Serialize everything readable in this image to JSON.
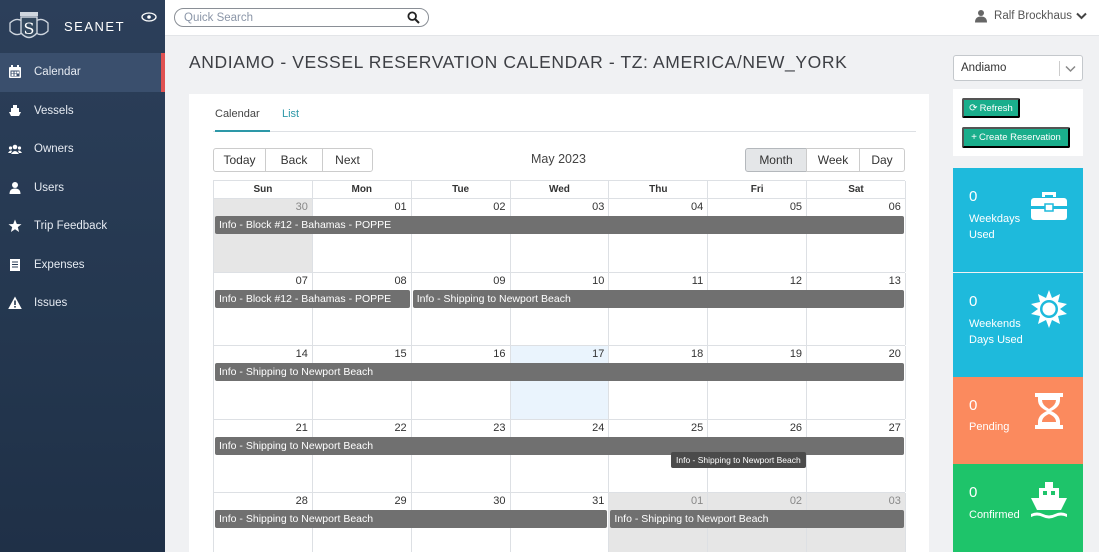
{
  "brand": {
    "name": "SEANET",
    "logo_letter": "S"
  },
  "sidebar": {
    "items": [
      {
        "label": "Calendar",
        "icon": "calendar-icon",
        "active": true
      },
      {
        "label": "Vessels",
        "icon": "ship-icon"
      },
      {
        "label": "Owners",
        "icon": "users-icon"
      },
      {
        "label": "Users",
        "icon": "user-icon"
      },
      {
        "label": "Trip Feedback",
        "icon": "star-icon"
      },
      {
        "label": "Expenses",
        "icon": "receipt-icon"
      },
      {
        "label": "Issues",
        "icon": "warning-icon"
      }
    ]
  },
  "topbar": {
    "search_placeholder": "Quick Search",
    "user_name": "Ralf Brockhaus"
  },
  "page": {
    "title": "ANDIAMO - VESSEL RESERVATION CALENDAR - TZ: AMERICA/NEW_YORK"
  },
  "calendar": {
    "tabs": [
      "Calendar",
      "List"
    ],
    "nav_buttons": [
      "Today",
      "Back",
      "Next"
    ],
    "month_label": "May 2023",
    "view_buttons": [
      "Month",
      "Week",
      "Day"
    ],
    "active_view": "Month",
    "weekdays": [
      "Sun",
      "Mon",
      "Tue",
      "Wed",
      "Thu",
      "Fri",
      "Sat"
    ],
    "weeks": [
      {
        "days": [
          "30",
          "01",
          "02",
          "03",
          "04",
          "05",
          "06"
        ],
        "off": [
          0
        ],
        "today": -1,
        "events": [
          {
            "title": "Info - Block #12 - Bahamas - POPPE",
            "start": 0,
            "span": 7
          }
        ]
      },
      {
        "days": [
          "07",
          "08",
          "09",
          "10",
          "11",
          "12",
          "13"
        ],
        "off": [],
        "today": -1,
        "events": [
          {
            "title": "Info - Block #12 - Bahamas - POPPE",
            "start": 0,
            "span": 2
          },
          {
            "title": "Info - Shipping to Newport Beach",
            "start": 2,
            "span": 5
          }
        ]
      },
      {
        "days": [
          "14",
          "15",
          "16",
          "17",
          "18",
          "19",
          "20"
        ],
        "off": [],
        "today": 3,
        "events": [
          {
            "title": "Info - Shipping to Newport Beach",
            "start": 0,
            "span": 7
          }
        ]
      },
      {
        "days": [
          "21",
          "22",
          "23",
          "24",
          "25",
          "26",
          "27"
        ],
        "off": [],
        "today": -1,
        "events": [
          {
            "title": "Info - Shipping to Newport Beach",
            "start": 0,
            "span": 7
          }
        ]
      },
      {
        "days": [
          "28",
          "29",
          "30",
          "31",
          "01",
          "02",
          "03"
        ],
        "off": [
          4,
          5,
          6
        ],
        "today": -1,
        "events": [
          {
            "title": "Info - Shipping to Newport Beach",
            "start": 0,
            "span": 4
          },
          {
            "title": "Info - Shipping to Newport Beach",
            "start": 4,
            "span": 3
          }
        ]
      }
    ],
    "tooltip": "Info - Shipping to Newport Beach"
  },
  "right_panel": {
    "vessel_select": "Andiamo",
    "refresh_label": "Refresh",
    "create_label": "Create Reservation",
    "stats": [
      {
        "value": "0",
        "label": "Weekdays Used",
        "color": "#1ebadc",
        "icon": "toolbox-icon"
      },
      {
        "value": "0",
        "label": "Weekends Days Used",
        "color": "#1ebadc",
        "icon": "sun-icon"
      },
      {
        "value": "0",
        "label": "Pending",
        "color": "#fb8a5e",
        "icon": "hourglass-icon"
      },
      {
        "value": "0",
        "label": "Confirmed",
        "color": "#1ec46a",
        "icon": "ship-icon"
      }
    ]
  }
}
